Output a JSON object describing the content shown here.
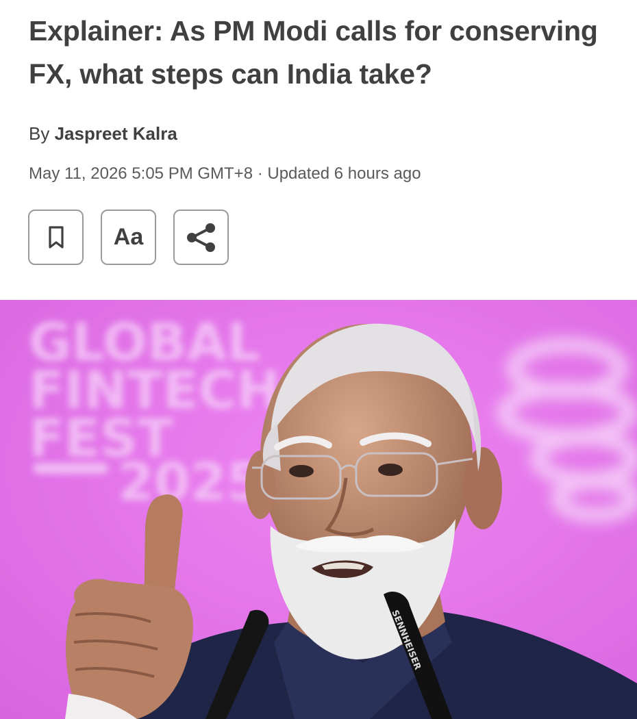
{
  "article": {
    "headline": "Explainer: As PM Modi calls for conserving FX, what steps can India take?",
    "byline_prefix": "By",
    "author": "Jaspreet Kalra",
    "dateline": "May 11, 2026 5:05 PM GMT+8 · Updated 6 hours ago"
  },
  "toolbar": {
    "bookmark_icon": "bookmark-icon",
    "text_size_label": "Aa",
    "share_icon": "share-icon"
  },
  "photo": {
    "backdrop_lines": [
      "GLOBAL",
      "FINTECH",
      "FEST",
      "2025"
    ],
    "mic_brand": "SENNHEISER"
  },
  "colors": {
    "text": "#404040",
    "meta": "#5a5a5a",
    "button_border": "#9a9a9a",
    "photo_background": "#e377ea"
  }
}
